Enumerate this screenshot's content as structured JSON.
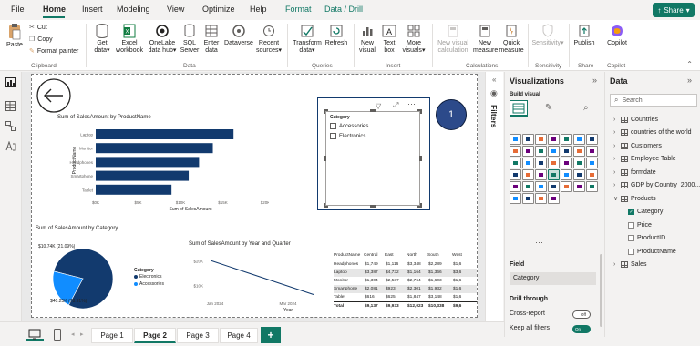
{
  "menu": {
    "tabs": [
      "File",
      "Home",
      "Insert",
      "Modeling",
      "View",
      "Optimize",
      "Help",
      "Format",
      "Data / Drill"
    ],
    "share_label": "Share"
  },
  "ribbon": {
    "paste": "Paste",
    "cut": "Cut",
    "copy": "Copy",
    "format_painter": "Format painter",
    "clipboard_group": "Clipboard",
    "get_data": [
      "Get",
      "data"
    ],
    "excel": [
      "Excel",
      "workbook"
    ],
    "onelake": [
      "OneLake",
      "data hub"
    ],
    "sql": [
      "SQL",
      "Server"
    ],
    "enter_data": [
      "Enter",
      "data"
    ],
    "dataverse": "Dataverse",
    "recent_sources": [
      "Recent",
      "sources"
    ],
    "data_group": "Data",
    "transform": [
      "Transform",
      "data"
    ],
    "refresh": "Refresh",
    "queries_group": "Queries",
    "new_visual": [
      "New",
      "visual"
    ],
    "text_box": [
      "Text",
      "box"
    ],
    "more_visuals": [
      "More",
      "visuals"
    ],
    "insert_group": "Insert",
    "new_visual_calc": [
      "New visual",
      "calculation"
    ],
    "new_measure": [
      "New",
      "measure"
    ],
    "quick_measure": [
      "Quick",
      "measure"
    ],
    "calculations_group": "Calculations",
    "sensitivity": "Sensitivity",
    "sensitivity_group": "Sensitivity",
    "publish": "Publish",
    "share_group": "Share",
    "copilot": "Copilot",
    "copilot_group": "Copilot"
  },
  "canvas": {
    "bar_title": "Sum of SalesAmount by ProductName",
    "bar_ylabel": "ProductName",
    "bar_xlabel": "Sum of SalesAmount",
    "pie_title": "Sum of SalesAmount by Category",
    "pie_label_top": "$10.74K (21.09%)",
    "pie_label_bottom": "$40.25K (78.91%)",
    "pie_legend_title": "Category",
    "line_title": "Sum of SalesAmount by Year and Quarter",
    "line_xlabel": "Year",
    "slicer_title": "Category",
    "slicer_items": [
      "Accessories",
      "Electronics"
    ],
    "badge": "1"
  },
  "chart_data": [
    {
      "type": "bar",
      "title": "Sum of SalesAmount by ProductName",
      "categories": [
        "Laptop",
        "Monitor",
        "Headphones",
        "Smartphone",
        "Tablet"
      ],
      "values": [
        20000,
        17000,
        15000,
        13500,
        11000
      ],
      "xlabel": "Sum of SalesAmount",
      "ylabel": "ProductName",
      "xticks": [
        "$0K",
        "$5K",
        "$10K",
        "$15K",
        "$20K"
      ],
      "xlim": [
        0,
        20000
      ]
    },
    {
      "type": "pie",
      "title": "Sum of SalesAmount by Category",
      "slices": [
        {
          "name": "Electronics",
          "value": 40.25,
          "color": "#123a6e"
        },
        {
          "name": "Accessories",
          "value": 10.74,
          "color": "#118dff"
        }
      ],
      "legend": "right"
    },
    {
      "type": "line",
      "title": "Sum of SalesAmount by Year and Quarter",
      "x": [
        "Jan 2024",
        "Mar 2024"
      ],
      "y": [
        20000,
        10000
      ],
      "yticks": [
        "$20K",
        "$10K"
      ],
      "xlabel": "Year",
      "ylim": [
        5000,
        22000
      ]
    }
  ],
  "matrix": {
    "headers": [
      "ProductName",
      "Central",
      "East",
      "North",
      "South",
      "West"
    ],
    "rows": [
      [
        "Headphones",
        "$1,749",
        "$1,116",
        "$3,348",
        "$2,289",
        "$1,6"
      ],
      [
        "Laptop",
        "$3,387",
        "$4,732",
        "$1,164",
        "$1,366",
        "$3,6"
      ],
      [
        "Monitor",
        "$1,304",
        "$2,537",
        "$2,764",
        "$1,603",
        "$1,6"
      ],
      [
        "Smartphone",
        "$2,081",
        "$923",
        "$2,301",
        "$1,932",
        "$1,6"
      ],
      [
        "Tablet",
        "$616",
        "$625",
        "$1,847",
        "$3,148",
        "$1,6"
      ],
      [
        "Total",
        "$9,137",
        "$9,933",
        "$12,023",
        "$10,338",
        "$9,6"
      ]
    ]
  },
  "filters_label": "Filters",
  "viz": {
    "title": "Visualizations",
    "build_visual": "Build visual",
    "field_label": "Field",
    "field_value": "Category",
    "drill_through": "Drill through",
    "cross_report": "Cross-report",
    "cross_report_state": "Off",
    "keep_filters": "Keep all filters",
    "keep_filters_state": "On"
  },
  "data_pane": {
    "title": "Data",
    "search_placeholder": "Search",
    "tables": [
      "Countries",
      "countries of the world",
      "Customers",
      "Employee Table",
      "formdate",
      "GDP by Country_2000...",
      "Products"
    ],
    "products_fields": [
      "Category",
      "Price",
      "ProductID",
      "ProductName"
    ],
    "sales": "Sales"
  },
  "pages": [
    "Page 1",
    "Page 2",
    "Page 3",
    "Page 4"
  ],
  "add_page": "+",
  "colors": {
    "accent": "#117865",
    "navy": "#123a6e",
    "blue": "#118dff"
  }
}
